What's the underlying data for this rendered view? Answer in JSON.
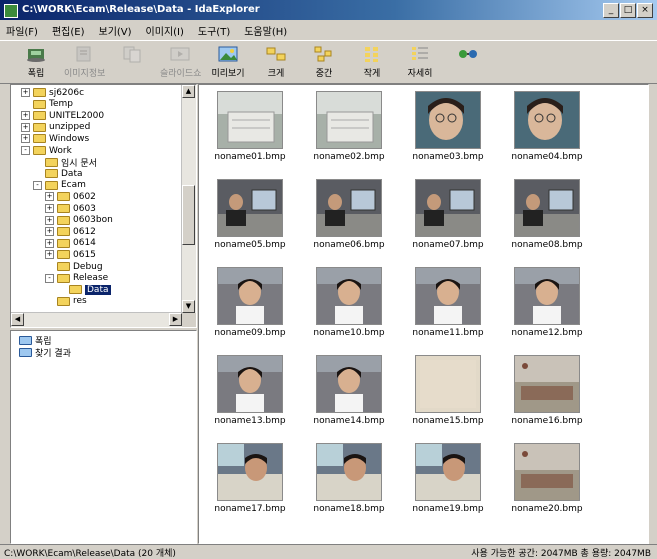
{
  "window": {
    "title": "C:\\WORK\\Ecam\\Release\\Data - IdaExplorer",
    "min": "_",
    "max": "□",
    "close": "×"
  },
  "menu": [
    "파일(F)",
    "편집(E)",
    "보기(V)",
    "이미지(I)",
    "도구(T)",
    "도움말(H)"
  ],
  "toolbar": [
    {
      "label": "폭립",
      "icon": "disk-icon",
      "disabled": false
    },
    {
      "label": "이미지정보",
      "icon": "info-icon",
      "disabled": true
    },
    {
      "label": "",
      "icon": "copy-icon",
      "disabled": true
    },
    {
      "label": "슬라이드쇼",
      "icon": "slideshow-icon",
      "disabled": true
    },
    {
      "label": "미리보기",
      "icon": "image-icon",
      "disabled": false
    },
    {
      "label": "크게",
      "icon": "large-icons-icon",
      "disabled": false
    },
    {
      "label": "중간",
      "icon": "medium-icons-icon",
      "disabled": false
    },
    {
      "label": "작게",
      "icon": "small-icons-icon",
      "disabled": false
    },
    {
      "label": "자세히",
      "icon": "details-icon",
      "disabled": false
    },
    {
      "label": "",
      "icon": "network-icon",
      "disabled": false
    }
  ],
  "tree": [
    {
      "label": "sj6206c",
      "depth": 2,
      "pm": "+"
    },
    {
      "label": "Temp",
      "depth": 2,
      "pm": ""
    },
    {
      "label": "UNITEL2000",
      "depth": 2,
      "pm": "+"
    },
    {
      "label": "unzipped",
      "depth": 2,
      "pm": "+"
    },
    {
      "label": "Windows",
      "depth": 2,
      "pm": "+"
    },
    {
      "label": "Work",
      "depth": 2,
      "pm": "-"
    },
    {
      "label": "임시 문서",
      "depth": 3,
      "pm": ""
    },
    {
      "label": "Data",
      "depth": 3,
      "pm": ""
    },
    {
      "label": "Ecam",
      "depth": 3,
      "pm": "-"
    },
    {
      "label": "0602",
      "depth": 4,
      "pm": "+"
    },
    {
      "label": "0603",
      "depth": 4,
      "pm": "+"
    },
    {
      "label": "0603bon",
      "depth": 4,
      "pm": "+"
    },
    {
      "label": "0612",
      "depth": 4,
      "pm": "+"
    },
    {
      "label": "0614",
      "depth": 4,
      "pm": "+"
    },
    {
      "label": "0615",
      "depth": 4,
      "pm": "+"
    },
    {
      "label": "Debug",
      "depth": 4,
      "pm": ""
    },
    {
      "label": "Release",
      "depth": 4,
      "pm": "-"
    },
    {
      "label": "Data",
      "depth": 5,
      "pm": "",
      "selected": true
    },
    {
      "label": "res",
      "depth": 4,
      "pm": ""
    }
  ],
  "tree2": [
    {
      "label": "폭립"
    },
    {
      "label": "찾기 결과"
    }
  ],
  "images": [
    {
      "name": "noname01.bmp",
      "kind": "desk"
    },
    {
      "name": "noname02.bmp",
      "kind": "desk"
    },
    {
      "name": "noname03.bmp",
      "kind": "face"
    },
    {
      "name": "noname04.bmp",
      "kind": "face"
    },
    {
      "name": "noname05.bmp",
      "kind": "office"
    },
    {
      "name": "noname06.bmp",
      "kind": "office"
    },
    {
      "name": "noname07.bmp",
      "kind": "office"
    },
    {
      "name": "noname08.bmp",
      "kind": "office"
    },
    {
      "name": "noname09.bmp",
      "kind": "woman"
    },
    {
      "name": "noname10.bmp",
      "kind": "woman"
    },
    {
      "name": "noname11.bmp",
      "kind": "woman"
    },
    {
      "name": "noname12.bmp",
      "kind": "woman"
    },
    {
      "name": "noname13.bmp",
      "kind": "woman"
    },
    {
      "name": "noname14.bmp",
      "kind": "woman"
    },
    {
      "name": "noname15.bmp",
      "kind": "blank"
    },
    {
      "name": "noname16.bmp",
      "kind": "room"
    },
    {
      "name": "noname17.bmp",
      "kind": "man"
    },
    {
      "name": "noname18.bmp",
      "kind": "man"
    },
    {
      "name": "noname19.bmp",
      "kind": "man"
    },
    {
      "name": "noname20.bmp",
      "kind": "room"
    }
  ],
  "status": {
    "left": "C:\\WORK\\Ecam\\Release\\Data (20 개체)",
    "right": "사용 가능한 공간: 2047MB 총 용량: 2047MB"
  }
}
